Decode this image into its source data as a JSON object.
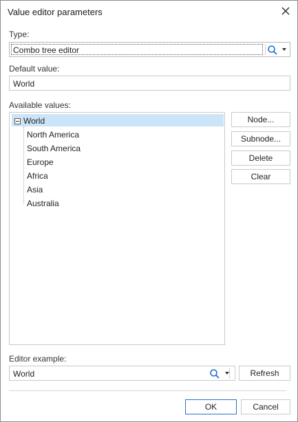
{
  "window": {
    "title": "Value editor parameters"
  },
  "type": {
    "label": "Type:",
    "value": "Combo tree editor"
  },
  "default_value": {
    "label": "Default value:",
    "value": "World"
  },
  "available": {
    "label": "Available values:",
    "root": "World",
    "children": [
      "North America",
      "South America",
      "Europe",
      "Africa",
      "Asia",
      "Australia"
    ]
  },
  "buttons": {
    "node": "Node...",
    "subnode": "Subnode...",
    "delete": "Delete",
    "clear": "Clear"
  },
  "editor_example": {
    "label": "Editor example:",
    "value": "World",
    "refresh": "Refresh"
  },
  "footer": {
    "ok": "OK",
    "cancel": "Cancel"
  },
  "colors": {
    "selection": "#cce4f7",
    "ok_border": "#2a6fc9",
    "search_icon": "#1e6fd0"
  },
  "icons": [
    "close-icon",
    "search-icon",
    "dropdown-arrow-icon",
    "collapse-icon"
  ]
}
